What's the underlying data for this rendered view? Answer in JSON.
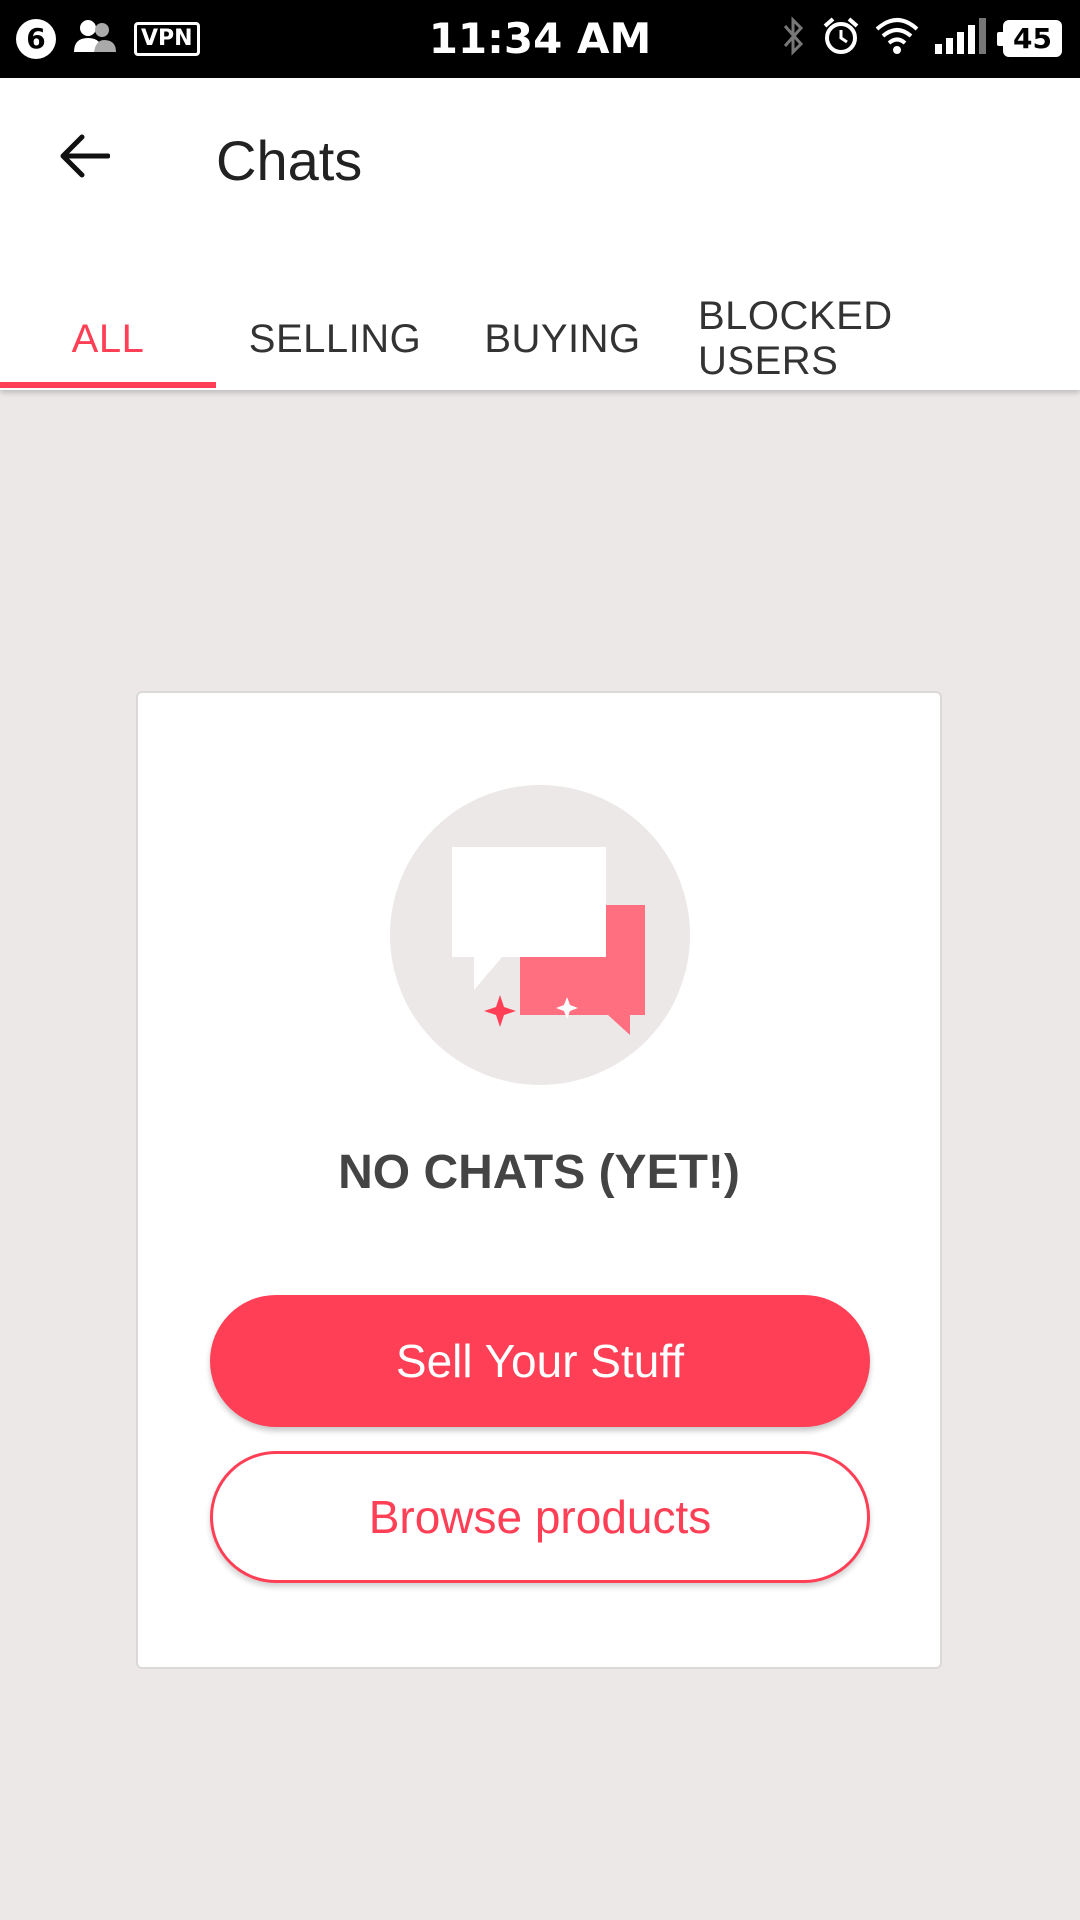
{
  "status_bar": {
    "notification_count": "6",
    "vpn_label": "VPN",
    "time": "11:34 AM",
    "battery": "45"
  },
  "app_bar": {
    "title": "Chats",
    "back_icon": "arrow-left-icon"
  },
  "tabs": [
    {
      "label": "ALL",
      "active": true
    },
    {
      "label": "SELLING",
      "active": false
    },
    {
      "label": "BUYING",
      "active": false
    },
    {
      "label": "BLOCKED USERS",
      "active": false
    }
  ],
  "empty_state": {
    "illustration_icon": "chat-bubbles-icon",
    "title": "NO CHATS (YET!)",
    "primary_button": "Sell Your Stuff",
    "secondary_button": "Browse products"
  },
  "colors": {
    "accent": "#ff3f55",
    "background": "#ece8e8",
    "card": "#ffffff"
  }
}
